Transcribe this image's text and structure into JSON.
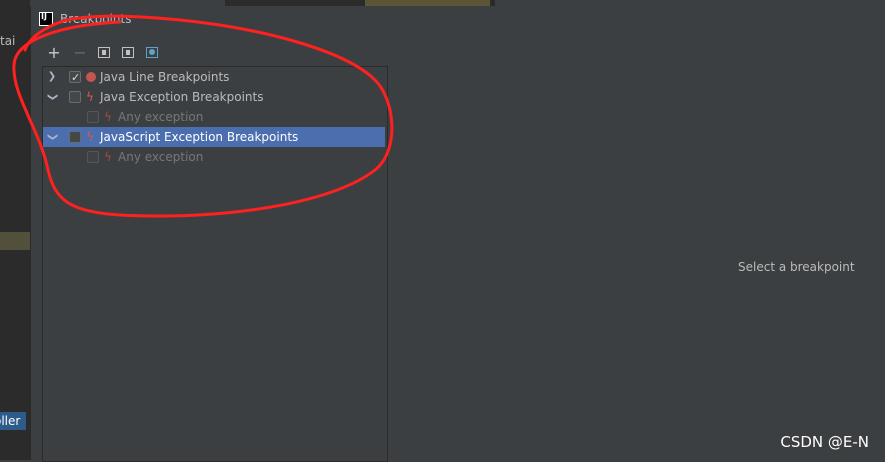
{
  "background": {
    "partial_text": "tai",
    "partial_button_text": "oller"
  },
  "dialog": {
    "title": "Breakpoints",
    "toolbar": {
      "add_label": "+",
      "remove_label": "−"
    },
    "tree": [
      {
        "label": "Java Line Breakpoints",
        "expanded": false,
        "checked": true,
        "icon": "red-dot-icon",
        "dim": false,
        "selected": false
      },
      {
        "label": "Java Exception Breakpoints",
        "expanded": true,
        "checked": false,
        "icon": "lightning-icon",
        "dim": false,
        "selected": false
      },
      {
        "label": "Any exception",
        "checked": false,
        "icon": "lightning-icon",
        "dim": true,
        "selected": false
      },
      {
        "label": "JavaScript Exception Breakpoints",
        "expanded": true,
        "checked": false,
        "icon": "lightning-icon",
        "dim": false,
        "selected": true
      },
      {
        "label": "Any exception",
        "checked": false,
        "icon": "lightning-icon",
        "dim": true,
        "selected": false
      }
    ],
    "detail_placeholder": "Select a breakpoint"
  },
  "watermark": "CSDN @E-N",
  "colors": {
    "selection": "#4b6eaf",
    "annotation": "#ff2020",
    "breakpoint": "#c75450"
  }
}
